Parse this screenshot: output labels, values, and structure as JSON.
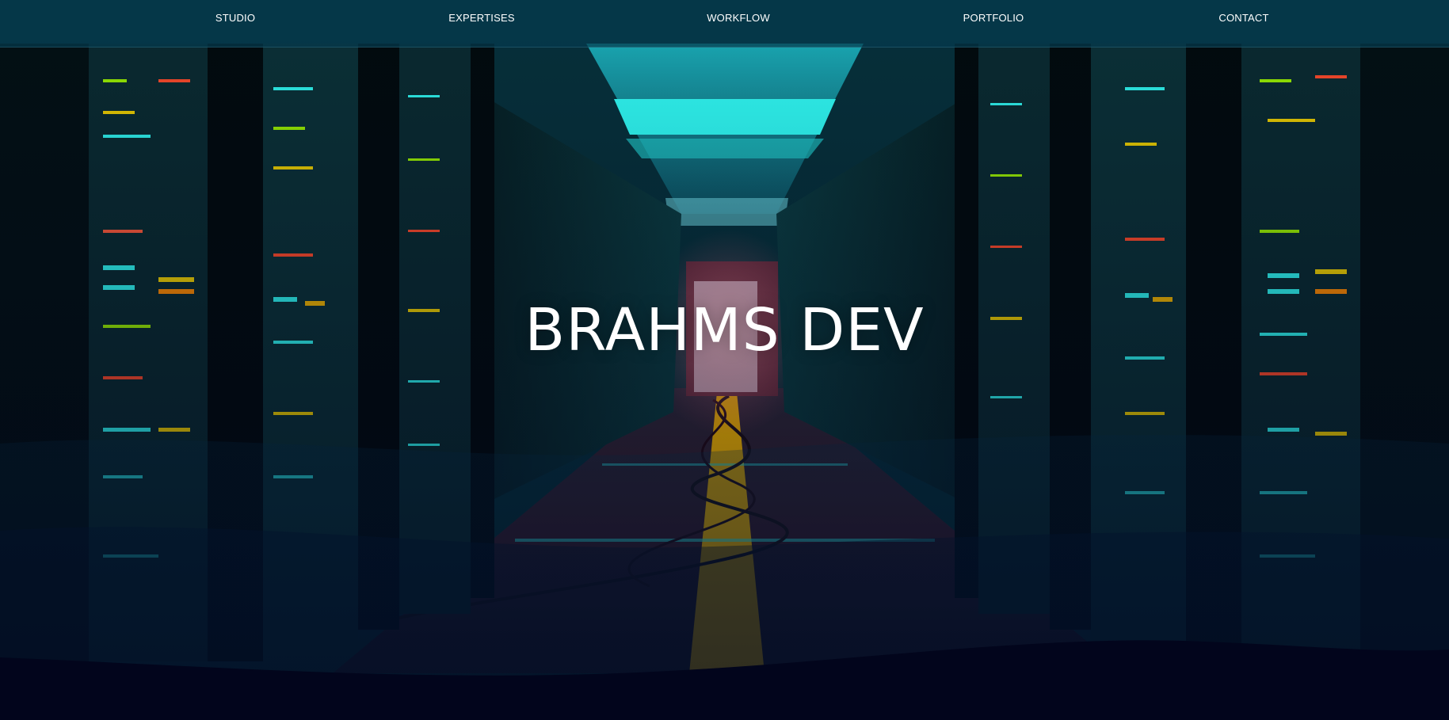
{
  "nav": {
    "items": [
      {
        "label": "STUDIO"
      },
      {
        "label": "EXPERTISES"
      },
      {
        "label": "WORKFLOW"
      },
      {
        "label": "PORTFOLIO"
      },
      {
        "label": "CONTACT"
      }
    ]
  },
  "hero": {
    "title": "BRAHMS DEV",
    "background_image": "server-room-corridor"
  },
  "colors": {
    "nav_bg": "#0a4458",
    "footer_bg": "#02051c",
    "accent_cyan": "#2ff6f0",
    "accent_yellow": "#f0b400"
  }
}
